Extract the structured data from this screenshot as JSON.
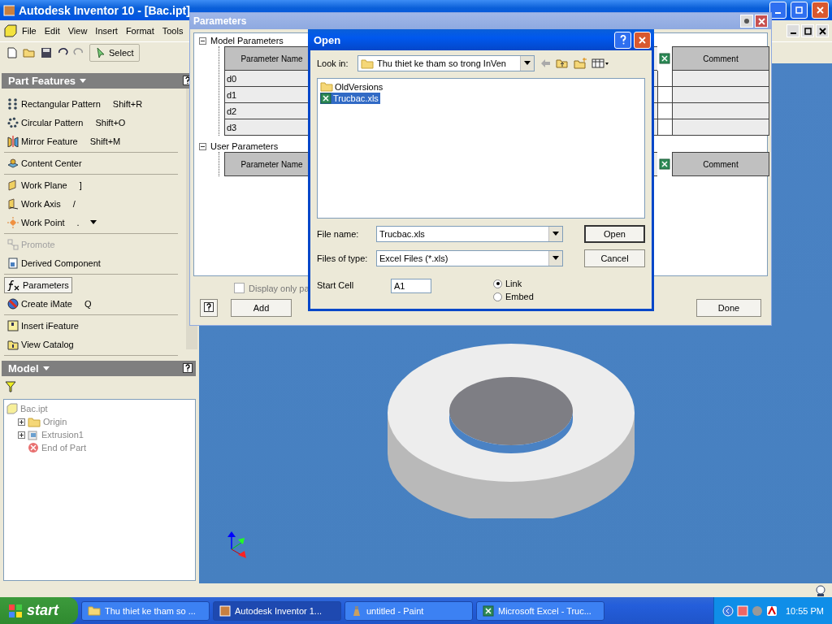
{
  "window": {
    "title": "Autodesk Inventor 10 - [Bac.ipt]"
  },
  "menu": [
    "File",
    "Edit",
    "View",
    "Insert",
    "Format",
    "Tools"
  ],
  "toolbar": {
    "select_label": "Select"
  },
  "part_features": {
    "title": "Part Features",
    "groups": [
      [
        {
          "label": "Rectangular Pattern",
          "shortcut": "Shift+R",
          "selected": false,
          "disabled": false
        },
        {
          "label": "Circular Pattern",
          "shortcut": "Shift+O",
          "selected": false,
          "disabled": false
        },
        {
          "label": "Mirror Feature",
          "shortcut": "Shift+M",
          "selected": false,
          "disabled": false
        }
      ],
      [
        {
          "label": "Content Center",
          "selected": false,
          "disabled": false
        }
      ],
      [
        {
          "label": "Work Plane",
          "shortcut": "]",
          "selected": false,
          "disabled": false
        },
        {
          "label": "Work Axis",
          "shortcut": "/",
          "selected": false,
          "disabled": false
        },
        {
          "label": "Work Point",
          "shortcut": ".",
          "selected": false,
          "disabled": false,
          "has_menu": true
        }
      ],
      [
        {
          "label": "Promote",
          "selected": false,
          "disabled": true
        },
        {
          "label": "Derived Component",
          "selected": false,
          "disabled": false
        }
      ],
      [
        {
          "label": "Parameters",
          "selected": true,
          "disabled": false
        },
        {
          "label": "Create iMate",
          "shortcut": "Q",
          "selected": false,
          "disabled": false
        }
      ],
      [
        {
          "label": "Insert iFeature",
          "selected": false,
          "disabled": false
        },
        {
          "label": "View Catalog",
          "selected": false,
          "disabled": false
        }
      ]
    ]
  },
  "model_browser": {
    "title": "Model",
    "tree": [
      {
        "label": "Bac.ipt",
        "kind": "part",
        "children": [
          {
            "label": "Origin",
            "kind": "folder",
            "expanded": false
          },
          {
            "label": "Extrusion1",
            "kind": "feature",
            "expanded": false
          },
          {
            "label": "End of Part",
            "kind": "end"
          }
        ]
      }
    ]
  },
  "parameters_dialog": {
    "title": "Parameters",
    "model_section": {
      "label": "Model Parameters",
      "expanded": true,
      "columns": [
        "Parameter Name",
        "Comment"
      ],
      "rows": [
        "d0",
        "d1",
        "d2",
        "d3"
      ]
    },
    "user_section": {
      "label": "User Parameters",
      "expanded": true,
      "columns": [
        "Parameter Name",
        "Comment"
      ]
    },
    "checkbox": {
      "label": "Display only pa",
      "checked": false
    },
    "buttons": [
      "Add",
      "Done"
    ]
  },
  "open_dialog": {
    "title": "Open",
    "look_in_label": "Look in:",
    "look_in": "Thu thiet ke tham so trong InVen",
    "files": [
      {
        "name": "OldVersions",
        "kind": "folder",
        "selected": false
      },
      {
        "name": "Trucbac.xls",
        "kind": "excel",
        "selected": true
      }
    ],
    "file_name_label": "File name:",
    "file_name": "Trucbac.xls",
    "file_type_label": "Files of type:",
    "file_type": "Excel Files (*.xls)",
    "buttons": [
      "Open",
      "Cancel"
    ],
    "start_cell_label": "Start Cell",
    "start_cell": "A1",
    "options": [
      {
        "label": "Link",
        "selected": true
      },
      {
        "label": "Embed",
        "selected": false
      }
    ]
  },
  "taskbar": {
    "start": "start",
    "tasks": [
      {
        "label": "Thu thiet ke tham so ...",
        "kind": "folder",
        "selected": false
      },
      {
        "label": "Autodesk Inventor 1...",
        "kind": "inventor",
        "selected": true
      },
      {
        "label": "untitled - Paint",
        "kind": "paint",
        "selected": false
      },
      {
        "label": "Microsoft Excel - Truc...",
        "kind": "excel",
        "selected": false
      }
    ],
    "clock": "10:55 PM"
  }
}
